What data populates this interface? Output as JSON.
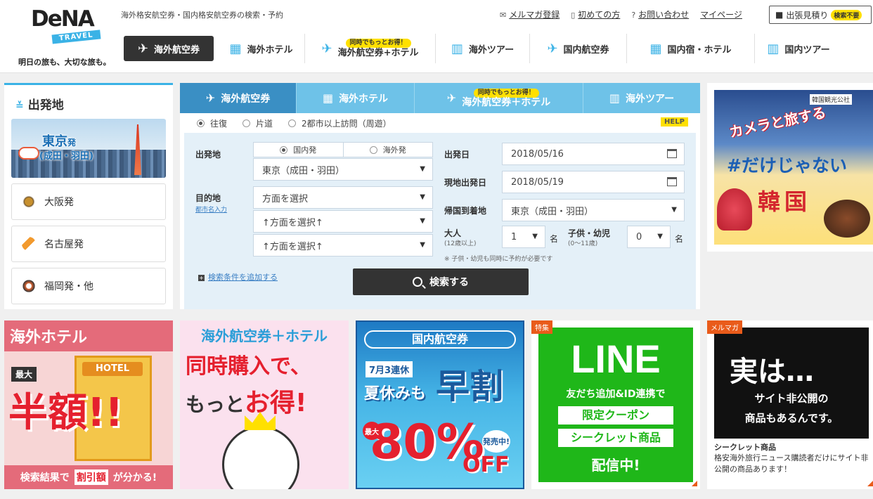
{
  "header": {
    "logo_text": "DeNA",
    "logo_sub": "TRAVEL",
    "logo_tagline": "明日の旅も、大切な旅も。",
    "tagline": "海外格安航空券・国内格安航空券の検索・予約",
    "links": [
      {
        "icon": "mail-icon",
        "glyph": "✉",
        "label": "メルマガ登録"
      },
      {
        "icon": "book-icon",
        "glyph": "▯",
        "label": "初めての方"
      },
      {
        "icon": "question-icon",
        "glyph": "?",
        "label": "お問い合わせ"
      },
      {
        "icon": "",
        "glyph": "",
        "label": "マイページ"
      }
    ],
    "estimate": {
      "label": "出張見積り",
      "badge": "検索不要"
    }
  },
  "nav": [
    {
      "label": "海外航空券",
      "glyph": "✈",
      "active": true
    },
    {
      "label": "海外ホテル",
      "glyph": "▦"
    },
    {
      "label": "海外航空券+ホテル",
      "glyph": "✈",
      "pill": "同時でもっとお得！"
    },
    {
      "label": "海外ツアー",
      "glyph": "▥"
    },
    {
      "label": "国内航空券",
      "glyph": "✈"
    },
    {
      "label": "国内宿・ホテル",
      "glyph": "▦"
    },
    {
      "label": "国内ツアー",
      "glyph": "▥"
    }
  ],
  "departure": {
    "heading": "出発地",
    "tokyo_main": "東京",
    "tokyo_suffix": "発",
    "tokyo_sub": "(成田・羽田)",
    "cities": [
      {
        "label": "大阪発"
      },
      {
        "label": "名古屋発"
      },
      {
        "label": "福岡発・他"
      }
    ]
  },
  "search": {
    "tabs": [
      {
        "label": "海外航空券",
        "glyph": "✈",
        "active": true
      },
      {
        "label": "海外ホテル",
        "glyph": "▦"
      },
      {
        "label": "海外航空券＋ホテル",
        "glyph": "✈",
        "pill": "同時でもっとお得！"
      },
      {
        "label": "海外ツアー",
        "glyph": "▥"
      }
    ],
    "trip_types": [
      "往復",
      "片道",
      "2都市以上訪問（周遊）"
    ],
    "help": "HELP",
    "origin_label": "出発地",
    "domestic": "国内発",
    "overseas": "海外発",
    "origin_value": "東京（成田・羽田）",
    "dest_label": "目的地",
    "city_input_link": "都市名入力",
    "dest_1": "方面を選択",
    "dest_2": "↑方面を選択↑",
    "dest_3": "↑方面を選択↑",
    "depart_date_label": "出発日",
    "depart_date": "2018/05/16",
    "local_date_label": "現地出発日",
    "local_date": "2018/05/19",
    "return_label": "帰国到着地",
    "return_value": "東京（成田・羽田）",
    "adult_label": "大人",
    "adult_sub": "(12歳以上)",
    "adult_value": "1",
    "child_label": "子供・幼児",
    "child_sub": "(0〜11歳)",
    "child_value": "0",
    "unit": "名",
    "note": "※ 子供・幼児も同時に予約が必要です",
    "add_conditions": "検索条件を追加する",
    "search_button": "検索する"
  },
  "korea_ad": {
    "line1": "カメラと旅する",
    "line2": "#だけじゃない",
    "line3": "韓国",
    "org": "韓国観光公社"
  },
  "banners": {
    "hotel": {
      "title": "海外ホテル",
      "sign": "HOTEL",
      "max": "最大",
      "big": "半額!!",
      "foot_pre": "検索結果で",
      "foot_hl": "割引額",
      "foot_post": "が分かる!"
    },
    "combo": {
      "title": "海外航空券＋ホテル",
      "l1": "同時購入で、",
      "l2_pre": "もっと",
      "l2_hl": "お得!"
    },
    "domestic": {
      "title": "国内航空券",
      "renkyu": "7月3連休",
      "natsu": "夏休みも",
      "haya": "早割",
      "max": "最大",
      "pct": "80%",
      "off": "OFF",
      "sale": "発売中!"
    },
    "line": {
      "tag": "特集",
      "title": "LINE",
      "p1": "友だち追加&ID連携で",
      "b1": "限定クーポン",
      "b2": "シークレット商品",
      "p2": "配信中!"
    },
    "mail": {
      "tag": "メルマガ",
      "l1": "実は…",
      "l2": "サイト非公開の",
      "l3": "商品もあるんです。",
      "sub_title": "シークレット商品",
      "sub_desc": "格安海外旅行ニュース購読者だけにサイト非公開の商品あります！"
    }
  }
}
